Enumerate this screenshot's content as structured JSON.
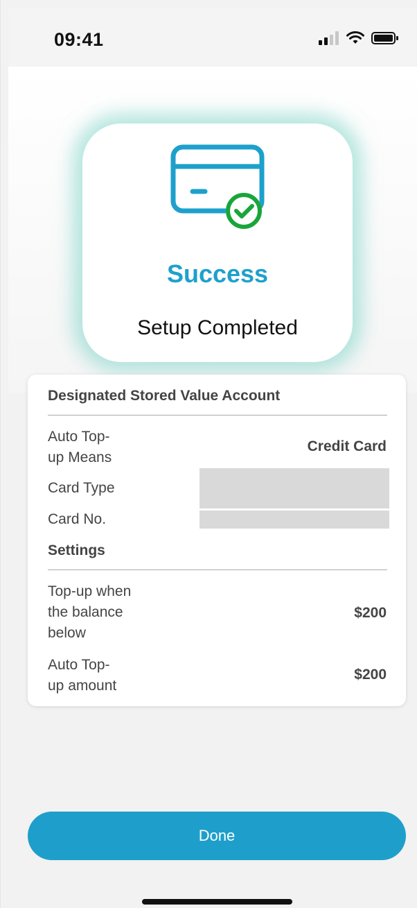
{
  "status_bar": {
    "time": "09:41"
  },
  "success": {
    "title": "Success",
    "subtitle": "Setup Completed",
    "icon": "credit-card-check-icon",
    "accent_color": "#1ea0cc",
    "check_color": "#19a53a"
  },
  "details": {
    "section1_title": "Designated Stored Value Account",
    "rows1": [
      {
        "label_line1": "Auto Top-",
        "label_line2": "up Means",
        "value": "Credit Card"
      },
      {
        "label": "Card Type",
        "value": ""
      },
      {
        "label": "Card No.",
        "value": ""
      }
    ],
    "section2_title": "Settings",
    "rows2": [
      {
        "label_line1": "Top-up when",
        "label_line2": "the balance",
        "label_line3": "below",
        "value": "$200"
      },
      {
        "label_line1": "Auto Top-",
        "label_line2": "up amount",
        "value": "$200"
      }
    ]
  },
  "actions": {
    "done_label": "Done",
    "button_color": "#1e9fcb"
  }
}
